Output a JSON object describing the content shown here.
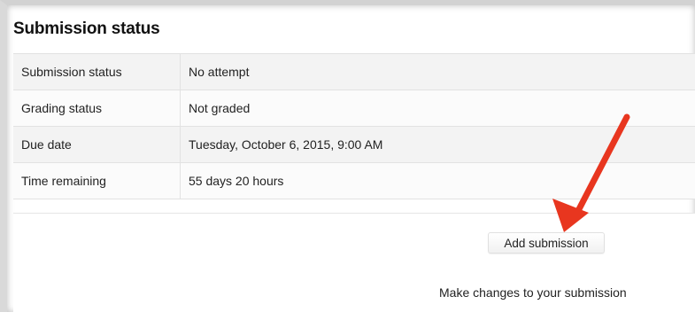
{
  "section": {
    "title": "Submission status"
  },
  "status_table": {
    "rows": [
      {
        "label": "Submission status",
        "value": "No attempt"
      },
      {
        "label": "Grading status",
        "value": "Not graded"
      },
      {
        "label": "Due date",
        "value": "Tuesday, October 6, 2015, 9:00 AM"
      },
      {
        "label": "Time remaining",
        "value": "55 days 20 hours"
      }
    ]
  },
  "actions": {
    "add_submission_label": "Add submission",
    "help_text": "Make changes to your submission"
  },
  "annotation": {
    "arrow_icon": "red-arrow-icon",
    "arrow_color": "#e8361f"
  }
}
